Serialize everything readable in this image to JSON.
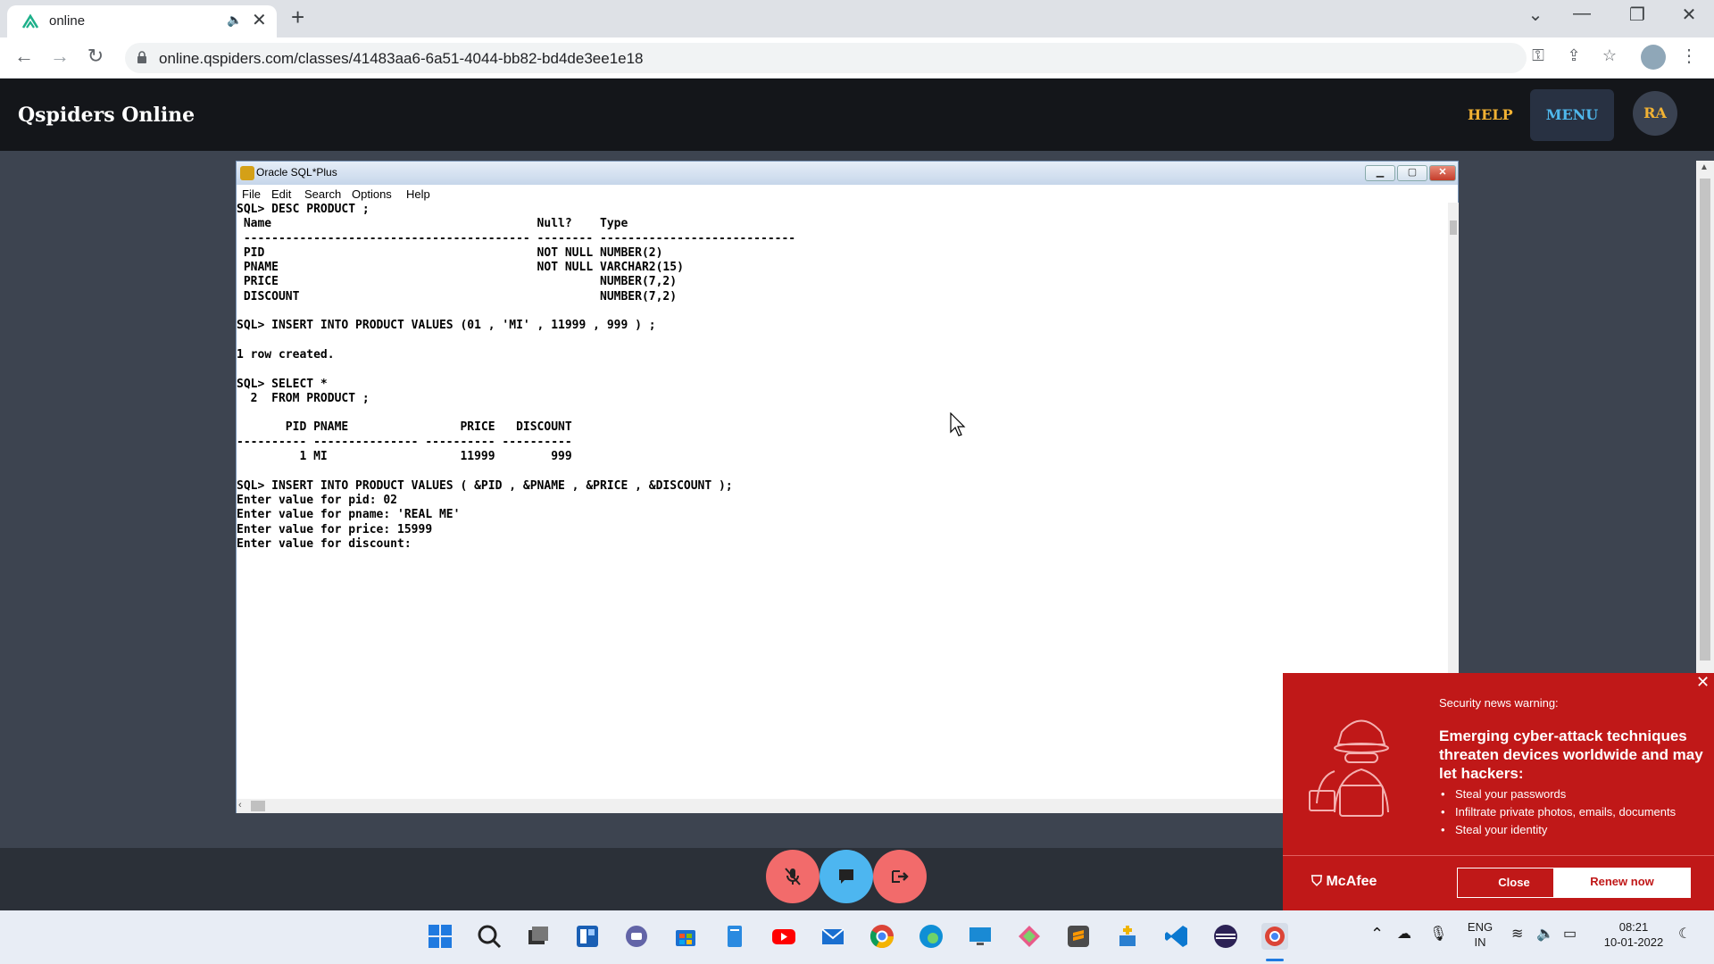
{
  "browser": {
    "tab_title": "online",
    "audio_glyph": "🔈",
    "close_glyph": "✕",
    "new_tab_glyph": "+",
    "url": "online.qspiders.com/classes/41483aa6-6a51-4044-bb82-bd4de3ee1e18",
    "controls": {
      "tablist": "⌄",
      "minimize": "—",
      "restore": "❐",
      "close": "✕"
    },
    "nav": {
      "back": "←",
      "forward": "→",
      "reload": "↻"
    },
    "tools": {
      "key": "⚿",
      "share": "⇪",
      "star": "☆",
      "kebab": "⋮"
    }
  },
  "app": {
    "brand": "Qspiders Online",
    "help": "HELP",
    "menu": "MENU",
    "user_initials": "RA"
  },
  "sqlplus": {
    "title": "Oracle SQL*Plus",
    "menu": [
      "File",
      "Edit",
      "Search",
      "Options",
      "Help"
    ],
    "lines": [
      "SQL> DESC PRODUCT ;",
      " Name                                      Null?    Type",
      " ----------------------------------------- -------- ----------------------------",
      " PID                                       NOT NULL NUMBER(2)",
      " PNAME                                     NOT NULL VARCHAR2(15)",
      " PRICE                                              NUMBER(7,2)",
      " DISCOUNT                                           NUMBER(7,2)",
      "",
      "SQL> INSERT INTO PRODUCT VALUES (01 , 'MI' , 11999 , 999 ) ;",
      "",
      "1 row created.",
      "",
      "SQL> SELECT *",
      "  2  FROM PRODUCT ;",
      "",
      "       PID PNAME                PRICE   DISCOUNT",
      "---------- --------------- ---------- ----------",
      "         1 MI                   11999        999",
      "",
      "SQL> INSERT INTO PRODUCT VALUES ( &PID , &PNAME , &PRICE , &DISCOUNT );",
      "Enter value for pid: 02",
      "Enter value for pname: 'REAL ME'",
      "Enter value for price: 15999",
      "Enter value for discount:"
    ]
  },
  "mcafee": {
    "kicker": "Security news warning:",
    "headline": "Emerging cyber-attack techniques threaten devices worldwide and may let hackers:",
    "bullets": [
      "Steal your passwords",
      "Infiltrate private photos, emails, documents",
      "Steal your identity"
    ],
    "logo": "McAfee",
    "close_label": "Close",
    "renew_label": "Renew now",
    "dismiss_glyph": "✕",
    "brand_color": "#c01818"
  },
  "taskbar": {
    "lang_line1": "ENG",
    "lang_line2": "IN",
    "time": "08:21",
    "date": "10-01-2022"
  },
  "colors": {
    "help": "#f2b233",
    "menu": "#4fb8ec",
    "call_red": "#f26b6b",
    "call_blue": "#4db6f0"
  }
}
